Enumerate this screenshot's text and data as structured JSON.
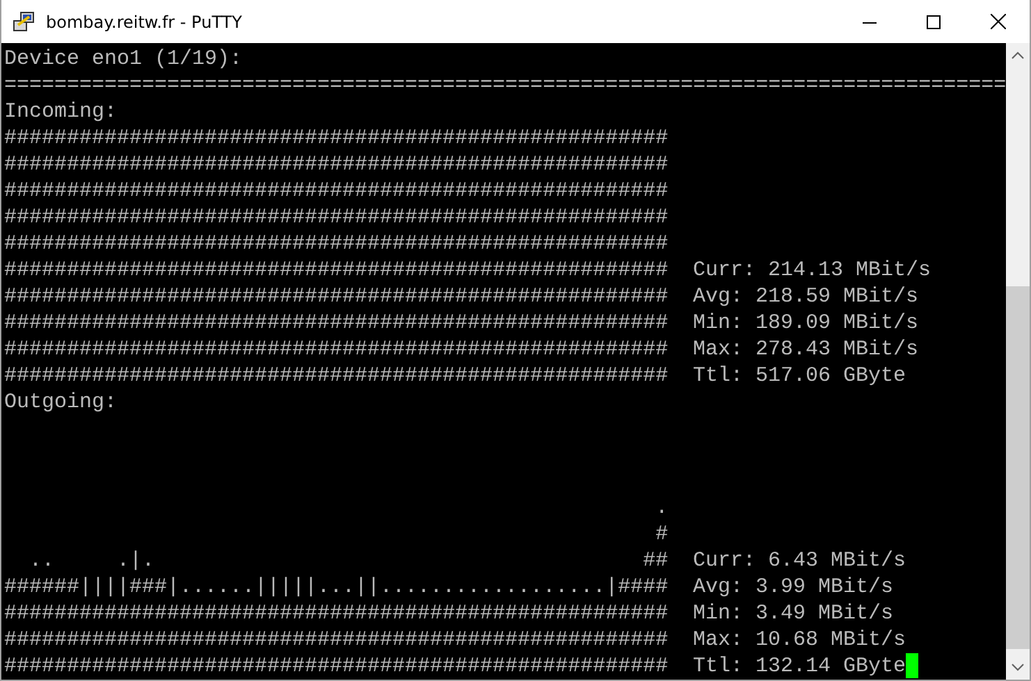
{
  "window": {
    "title": "bombay.reitw.fr - PuTTY"
  },
  "lines": [
    {
      "kind": "text",
      "text": "Device eno1 (1/19):"
    },
    {
      "kind": "rule",
      "text": "================================================================================"
    },
    {
      "kind": "text",
      "text": "Incoming:"
    },
    {
      "kind": "graph",
      "graph": "#####################################################"
    },
    {
      "kind": "graph",
      "graph": "#####################################################"
    },
    {
      "kind": "graph",
      "graph": "#####################################################"
    },
    {
      "kind": "graph",
      "graph": "#####################################################"
    },
    {
      "kind": "graph",
      "graph": "#####################################################"
    },
    {
      "kind": "graph",
      "graph": "#####################################################",
      "stat": "Curr: 214.13 MBit/s"
    },
    {
      "kind": "graph",
      "graph": "#####################################################",
      "stat": "Avg: 218.59 MBit/s"
    },
    {
      "kind": "graph",
      "graph": "#####################################################",
      "stat": "Min: 189.09 MBit/s"
    },
    {
      "kind": "graph",
      "graph": "#####################################################",
      "stat": "Max: 278.43 MBit/s"
    },
    {
      "kind": "graph",
      "graph": "#####################################################",
      "stat": "Ttl: 517.06 GByte"
    },
    {
      "kind": "text",
      "text": "Outgoing:"
    },
    {
      "kind": "blank"
    },
    {
      "kind": "blank"
    },
    {
      "kind": "blank"
    },
    {
      "kind": "graph",
      "graph": "                                                    ."
    },
    {
      "kind": "graph",
      "graph": "                                                    #"
    },
    {
      "kind": "graph",
      "graph": "  ..     .|.                                       ##",
      "stat": "Curr: 6.43 MBit/s"
    },
    {
      "kind": "graph",
      "graph": "######||||###|......|||||...||..................|####",
      "stat": "Avg: 3.99 MBit/s"
    },
    {
      "kind": "graph",
      "graph": "#####################################################",
      "stat": "Min: 3.49 MBit/s"
    },
    {
      "kind": "graph",
      "graph": "#####################################################",
      "stat": "Max: 10.68 MBit/s"
    },
    {
      "kind": "graph",
      "graph": "#####################################################",
      "stat": "Ttl: 132.14 GByte",
      "cursor": true
    }
  ]
}
